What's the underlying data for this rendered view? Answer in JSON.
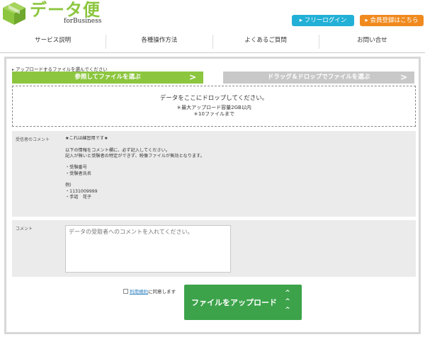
{
  "header": {
    "logo_main": "データ便",
    "logo_sub": "forBusiness",
    "login_label": "フリーログイン",
    "register_label": "会員登録はこちら"
  },
  "nav": {
    "items": [
      "サービス説明",
      "各種操作方法",
      "よくあるご質問",
      "お問い合せ"
    ]
  },
  "upload": {
    "instruction": "アップロードするファイルを選んでください",
    "tab_browse": "参照してファイルを選ぶ",
    "tab_drag": "ドラッグ＆ドロップでファイルを選ぶ",
    "drop_main": "データをここにドロップしてください。",
    "drop_limit_size": "＊最大アップロード容量2GB以内",
    "drop_limit_count": "＊10ファイルまで"
  },
  "recipient": {
    "label": "受信者のコメント",
    "lines": [
      "★これは練習用です★",
      "",
      "以下の情報をコメント欄に、必ず記入してください。",
      "記入が無いと受験者の特定ができず、映像ファイルが無効となります。",
      "",
      "・受験番号",
      "・受験者氏名",
      "",
      "例)",
      "・1131009999",
      "・手話　花子"
    ]
  },
  "comment": {
    "label": "コメント",
    "placeholder": "データの受取者へのコメントを入れてください。"
  },
  "agreement": {
    "link": "利用規約",
    "text": "に同意します"
  },
  "submit": {
    "label": "ファイルをアップロード"
  },
  "colors": {
    "brand_green": "#8cc63f",
    "login_blue": "#22b0d6",
    "register_orange": "#f08a1e",
    "upload_green": "#3ca34a"
  }
}
